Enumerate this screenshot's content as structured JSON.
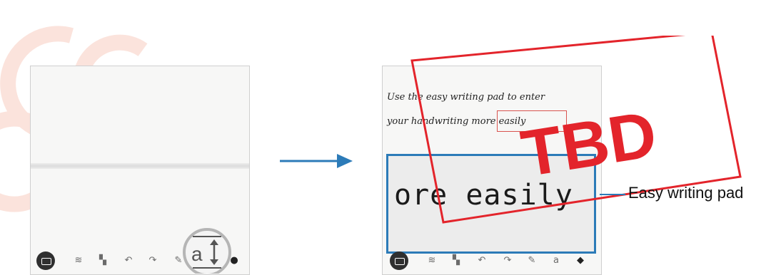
{
  "arrow_color": "#2c7bb8",
  "accent": "#2c7bb8",
  "stamp_color": "#e3242b",
  "left_screen": {
    "toolbar_icons": [
      "keyboard-icon",
      "text-style-icon",
      "highlighter-icon",
      "undo-icon",
      "redo-icon",
      "pen-icon",
      "easy-writing-pad-icon",
      "more-icon"
    ],
    "zoom_glyph": "a↕"
  },
  "right_screen": {
    "note_line1": "Use the easy writing pad to enter",
    "note_line2": "your handwriting more easily",
    "pad_text": "ore easily",
    "toolbar_icons": [
      "keyboard-icon",
      "text-style-icon",
      "highlighter-icon",
      "undo-icon",
      "redo-icon",
      "pen-icon",
      "easy-writing-pad-icon",
      "shapes-icon"
    ]
  },
  "callout": {
    "label": "Easy writing pad"
  },
  "stamp": {
    "text": "TBD"
  }
}
